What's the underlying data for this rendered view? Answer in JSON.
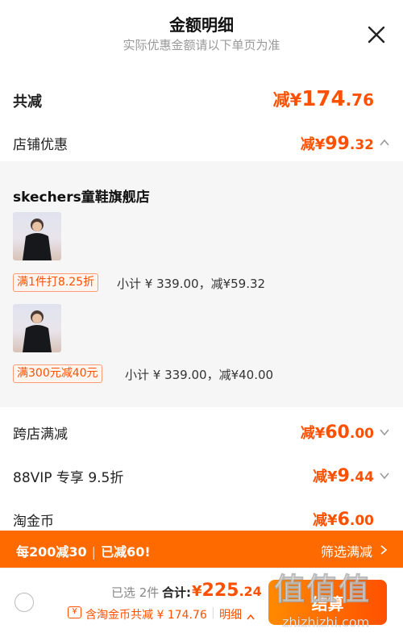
{
  "header": {
    "title": "金额明细",
    "subtitle": "实际优惠金额请以下单页为准"
  },
  "total": {
    "label": "共减",
    "prefix": "减",
    "currency": "¥",
    "int": "174",
    "dec": ".76"
  },
  "store_discount": {
    "label": "店铺优惠",
    "prefix": "减",
    "currency": "¥",
    "int": "99",
    "dec": ".32"
  },
  "shop": {
    "name": "skechers童鞋旗舰店",
    "items": [
      {
        "tag": "满1件打8.25折",
        "detail": "小计 ¥ 339.00，减¥59.32"
      },
      {
        "tag": "满300元减40元",
        "detail": "小计 ¥ 339.00，减¥40.00"
      }
    ]
  },
  "cross_store": {
    "label": "跨店满减",
    "prefix": "减",
    "currency": "¥",
    "int": "60",
    "dec": ".00"
  },
  "vip": {
    "label": "88VIP 专享 9.5折",
    "prefix": "减",
    "currency": "¥",
    "int": "9",
    "dec": ".44"
  },
  "coins": {
    "label": "淘金币",
    "prefix": "减",
    "currency": "¥",
    "int": "6",
    "dec": ".00"
  },
  "banner": {
    "left": "每200减30",
    "sep": "|",
    "right_text": "已减60!",
    "action": "筛选满减"
  },
  "footer": {
    "selected": "已选 2件",
    "total_label": "合计:",
    "currency": "¥",
    "total_int": "225",
    "total_dec": ".24",
    "coin_note": "含淘金币共减 ¥ 174.76",
    "detail_link": "明细",
    "checkout": "结算"
  },
  "watermark": "值值值",
  "watermark_url": "zhizhizhi.com",
  "colors": {
    "accent": "#ff5000",
    "banner": "#ff6a00",
    "panel": "#f6f6f6"
  }
}
